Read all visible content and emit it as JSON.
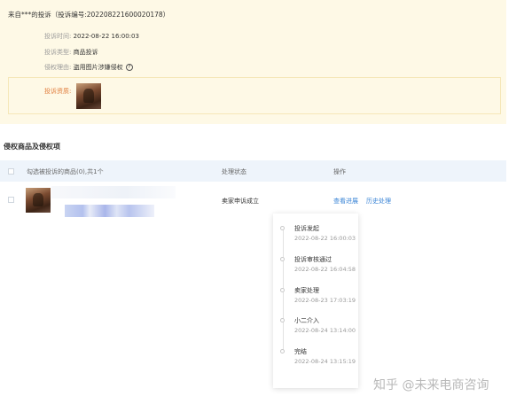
{
  "complaint": {
    "title": "来自***的投诉（投诉编号:202208221600020178）",
    "time_label": "投诉时间:",
    "time_value": "2022-08-22 16:00:03",
    "type_label": "投诉类型:",
    "type_value": "商品投诉",
    "reason_label": "侵权理由:",
    "reason_value": "盗用图片涉嫌侵权",
    "evidence_label": "投诉资质:"
  },
  "section": {
    "title": "侵权商品及侵权项"
  },
  "table": {
    "headers": {
      "product": "勾选被投诉的商品(0),共1个",
      "status": "处理状态",
      "actions": "操作"
    },
    "row": {
      "status": "卖家申诉成立",
      "view_progress": "查看进展",
      "history": "历史处理"
    }
  },
  "timeline": [
    {
      "label": "投诉发起",
      "time": "2022-08-22 16:00:03"
    },
    {
      "label": "投诉审核通过",
      "time": "2022-08-22 16:04:58"
    },
    {
      "label": "卖家处理",
      "time": "2022-08-23 17:03:19"
    },
    {
      "label": "小二介入",
      "time": "2022-08-24 13:14:00"
    },
    {
      "label": "完结",
      "time": "2022-08-24 13:15:19"
    }
  ],
  "watermark": "知乎 @未来电商咨询",
  "colors": {
    "panel_bg": "#fef9e6",
    "link": "#3a84d6",
    "evidence_label": "#e07b3a",
    "table_head_bg": "#eef4fb"
  },
  "icons": {
    "help": "question-circle-icon"
  }
}
